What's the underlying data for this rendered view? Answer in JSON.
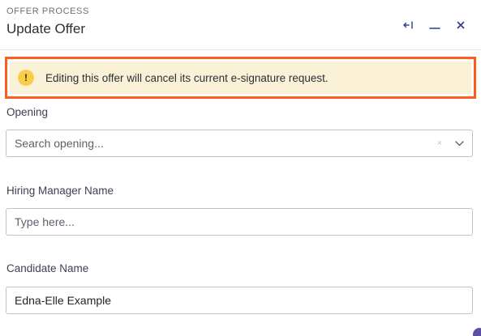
{
  "header": {
    "eyebrow": "OFFER PROCESS",
    "title": "Update Offer",
    "controls": {
      "collapse_icon": "collapse-arrow-icon",
      "minimize_icon": "minimize-icon",
      "close_icon": "close-icon"
    }
  },
  "alert": {
    "icon": "!",
    "message": "Editing this offer will cancel its current e-signature request.",
    "background": "#fbf1d7",
    "outline_color": "#ff5a1f"
  },
  "fields": {
    "opening": {
      "label": "Opening",
      "placeholder": "Search opening...",
      "value": "",
      "clear_glyph": "×"
    },
    "hiring_manager": {
      "label": "Hiring Manager Name",
      "placeholder": "Type here...",
      "value": ""
    },
    "candidate": {
      "label": "Candidate Name",
      "placeholder": "",
      "value": "Edna-Elle Example"
    }
  }
}
